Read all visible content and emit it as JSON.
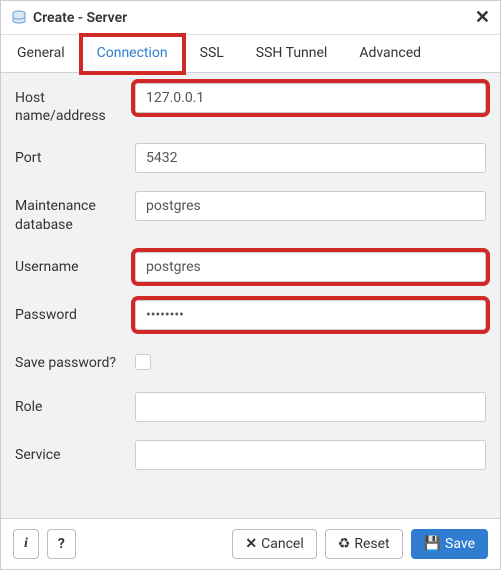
{
  "dialog": {
    "title": "Create - Server"
  },
  "tabs": [
    {
      "label": "General",
      "active": false,
      "highlighted": false
    },
    {
      "label": "Connection",
      "active": true,
      "highlighted": true
    },
    {
      "label": "SSL",
      "active": false,
      "highlighted": false
    },
    {
      "label": "SSH Tunnel",
      "active": false,
      "highlighted": false
    },
    {
      "label": "Advanced",
      "active": false,
      "highlighted": false
    }
  ],
  "form": {
    "host_label": "Host name/address",
    "host_value": "127.0.0.1",
    "port_label": "Port",
    "port_value": "5432",
    "maintdb_label": "Maintenance database",
    "maintdb_value": "postgres",
    "username_label": "Username",
    "username_value": "postgres",
    "password_label": "Password",
    "password_value": "••••••••",
    "savepass_label": "Save password?",
    "savepass_checked": false,
    "role_label": "Role",
    "role_value": "",
    "service_label": "Service",
    "service_value": ""
  },
  "footer": {
    "info_label": "i",
    "help_label": "?",
    "cancel_label": "Cancel",
    "reset_label": "Reset",
    "save_label": "Save"
  },
  "icons": {
    "close": "✕",
    "cancel_x": "✕",
    "reset": "♻",
    "save": "💾"
  }
}
